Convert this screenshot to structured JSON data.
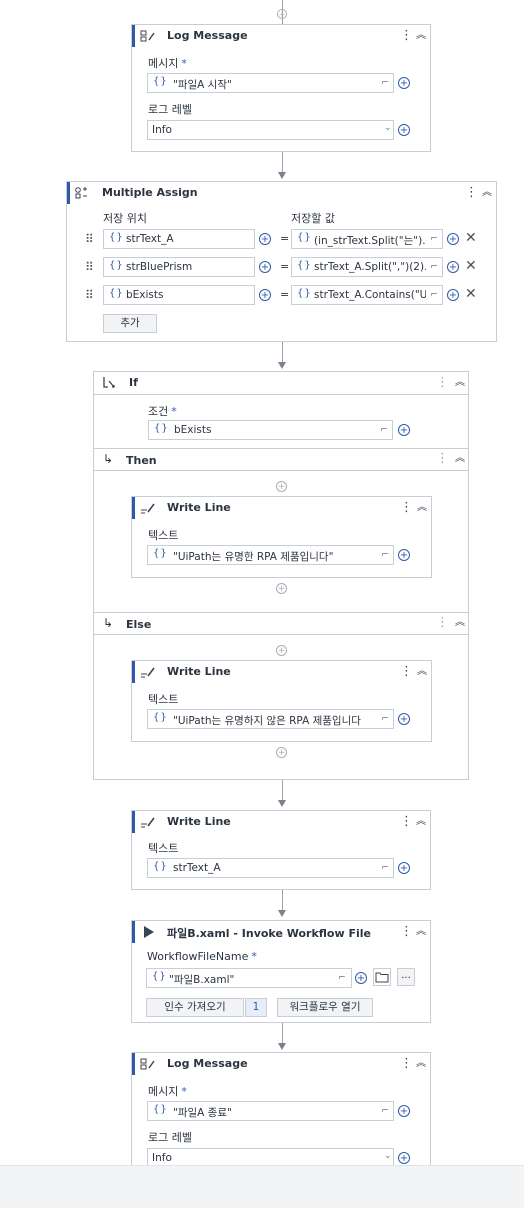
{
  "log_message_1": {
    "title": "Log Message",
    "message_label": "메시지",
    "required_mark": "*",
    "message_value": "\"파일A 시작\"",
    "level_label": "로그 레벨",
    "level_value": "Info"
  },
  "multiple_assign": {
    "title": "Multiple Assign",
    "col_target": "저장 위치",
    "col_value": "저장할 값",
    "rows": [
      {
        "target": "strText_A",
        "value": "(in_strText.Split(\"는\").l"
      },
      {
        "target": "strBluePrism",
        "value": "strText_A.Split(\",\")(2).1"
      },
      {
        "target": "bExists",
        "value": "strText_A.Contains(\"U"
      }
    ],
    "add_label": "추가"
  },
  "if_activity": {
    "title": "If",
    "condition_label": "조건",
    "required_mark": "*",
    "condition_value": "bExists",
    "then_label": "Then",
    "else_label": "Else",
    "then_write": {
      "title": "Write Line",
      "text_label": "텍스트",
      "text_value": "\"UiPath는 유명한 RPA 제품입니다\""
    },
    "else_write": {
      "title": "Write Line",
      "text_label": "텍스트",
      "text_value": "\"UiPath는 유명하지 않은 RPA 제품입니다"
    }
  },
  "write_line": {
    "title": "Write Line",
    "text_label": "텍스트",
    "text_value": "strText_A"
  },
  "invoke": {
    "title": "파일B.xaml - Invoke Workflow File",
    "file_label": "WorkflowFileName",
    "required_mark": "*",
    "file_value": "\"파일B.xaml\"",
    "import_args_label": "인수 가져오기",
    "args_count": "1",
    "open_workflow_label": "워크플로우 열기"
  },
  "log_message_2": {
    "title": "Log Message",
    "message_label": "메시지",
    "required_mark": "*",
    "message_value": "\"파일A 종료\"",
    "level_label": "로그 레벨",
    "level_value": "Info"
  },
  "icons": {
    "expression": "{}",
    "expand": "⌐",
    "plus": "+",
    "kebab": "⋮",
    "collapse": "︽",
    "remove": "✕",
    "grip": "⠿",
    "dropdown": "⌄",
    "then_arrow": "↳",
    "equals": "="
  },
  "colors": {
    "accent": "#2f5aa8",
    "border": "#c9ced6",
    "connector": "#9aa2ad"
  }
}
